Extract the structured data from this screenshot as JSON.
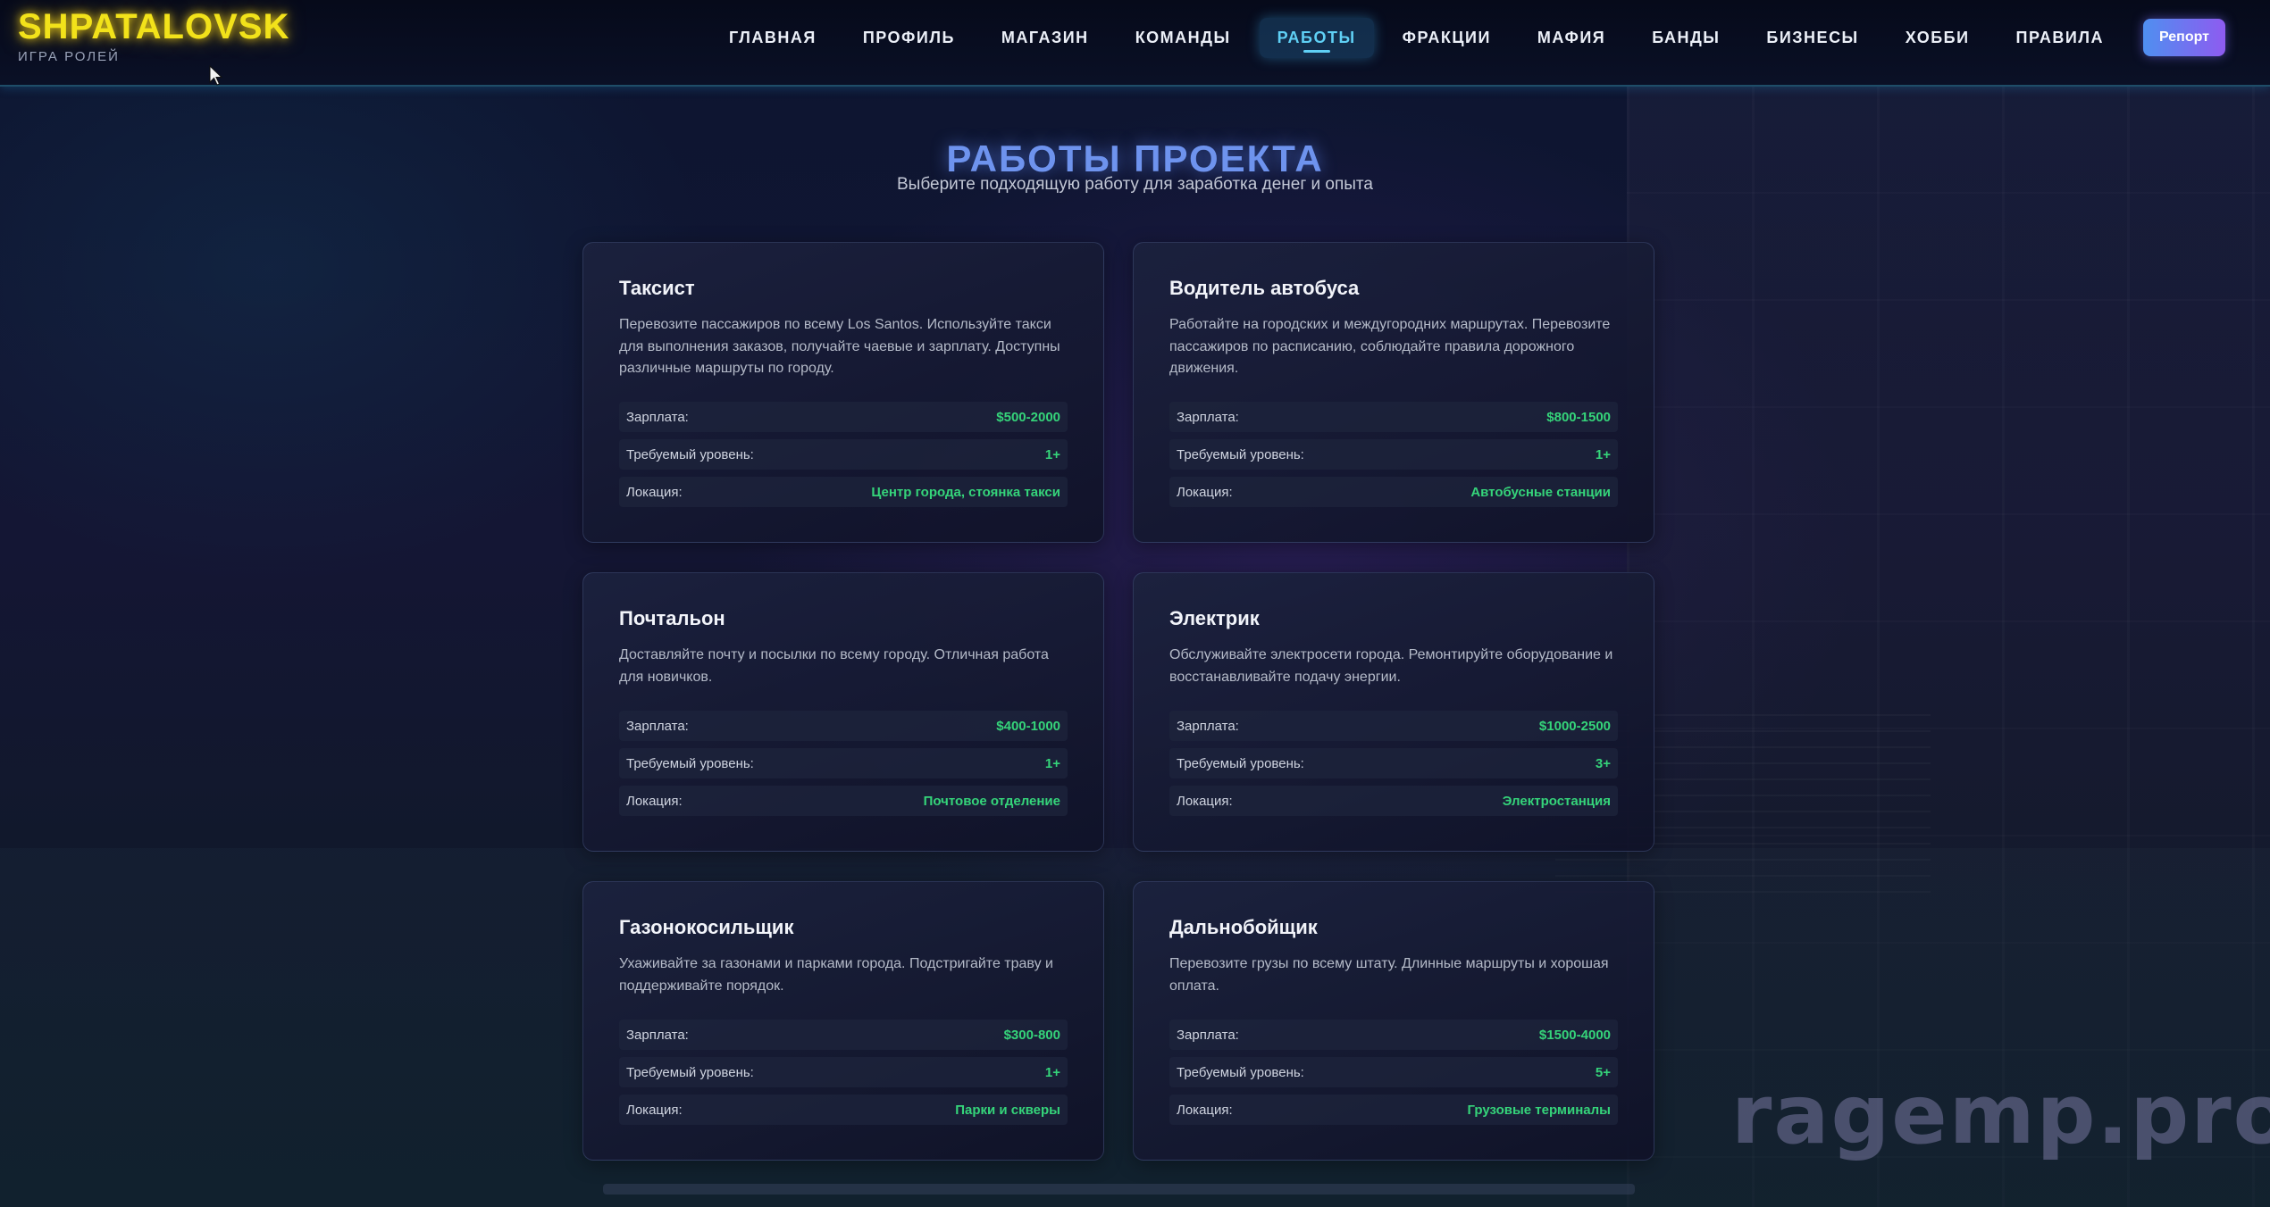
{
  "logo": {
    "title": "SHPATALOVSK",
    "subtitle": "ИГРА РОЛЕЙ"
  },
  "nav": {
    "items": [
      {
        "label": "ГЛАВНАЯ"
      },
      {
        "label": "ПРОФИЛЬ"
      },
      {
        "label": "МАГАЗИН"
      },
      {
        "label": "КОМАНДЫ"
      },
      {
        "label": "РАБОТЫ",
        "active": true
      },
      {
        "label": "ФРАКЦИИ"
      },
      {
        "label": "МАФИЯ"
      },
      {
        "label": "БАНДЫ"
      },
      {
        "label": "БИЗНЕСЫ"
      },
      {
        "label": "ХОББИ"
      },
      {
        "label": "ПРАВИЛА"
      }
    ],
    "report_label": "Репорт"
  },
  "hero": {
    "title": "РАБОТЫ ПРОЕКТА",
    "subtitle": "Выберите подходящую работу для заработка денег и опыта"
  },
  "stat_labels": {
    "salary": "Зарплата:",
    "level": "Требуемый уровень:",
    "location": "Локация:"
  },
  "jobs": [
    {
      "title": "Таксист",
      "description": "Перевозите пассажиров по всему Los Santos. Используйте такси для выполнения заказов, получайте чаевые и зарплату. Доступны различные маршруты по городу.",
      "salary": "$500-2000",
      "level": "1+",
      "location": "Центр города, стоянка такси"
    },
    {
      "title": "Водитель автобуса",
      "description": "Работайте на городских и междугородних маршрутах. Перевозите пассажиров по расписанию, соблюдайте правила дорожного движения.",
      "salary": "$800-1500",
      "level": "1+",
      "location": "Автобусные станции"
    },
    {
      "title": "Почтальон",
      "description": "Доставляйте почту и посылки по всему городу. Отличная работа для новичков.",
      "salary": "$400-1000",
      "level": "1+",
      "location": "Почтовое отделение"
    },
    {
      "title": "Электрик",
      "description": "Обслуживайте электросети города. Ремонтируйте оборудование и восстанавливайте подачу энергии.",
      "salary": "$1000-2500",
      "level": "3+",
      "location": "Электростанция"
    },
    {
      "title": "Газонокосильщик",
      "description": "Ухаживайте за газонами и парками города. Подстригайте траву и поддерживайте порядок.",
      "salary": "$300-800",
      "level": "1+",
      "location": "Парки и скверы"
    },
    {
      "title": "Дальнобойщик",
      "description": "Перевозите грузы по всему штату. Длинные маршруты и хорошая оплата.",
      "salary": "$1500-4000",
      "level": "5+",
      "location": "Грузовые терминалы"
    }
  ],
  "watermark": "ragemp.pro",
  "colors": {
    "accent": "#5fd0f5",
    "logo": "#f2e21a",
    "value_green": "#35d47a",
    "title_blue": "#6e93ee"
  }
}
